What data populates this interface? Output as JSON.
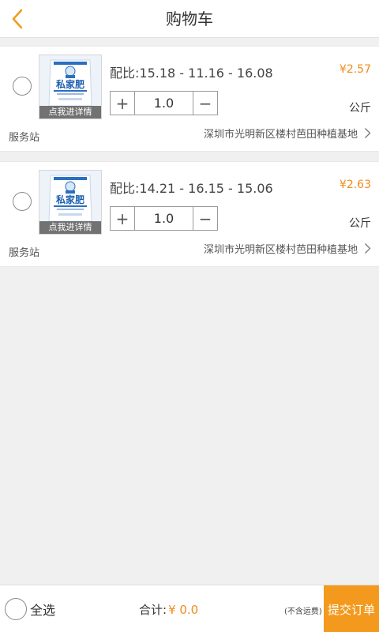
{
  "header": {
    "title": "购物车",
    "back_icon": "chevron-left-icon",
    "accent": "#f39a1e"
  },
  "items": [
    {
      "ratio": "配比:15.18 - 11.16 - 16.08",
      "price": "¥2.57",
      "quantity": "1.0",
      "unit": "公斤",
      "station_label": "服务站",
      "location": "深圳市光明新区楼村芭田种植基地",
      "thumbnail_caption": "点我进详情",
      "product_brand": "私家肥"
    },
    {
      "ratio": "配比:14.21 - 16.15 - 15.06",
      "price": "¥2.63",
      "quantity": "1.0",
      "unit": "公斤",
      "station_label": "服务站",
      "location": "深圳市光明新区楼村芭田种植基地",
      "thumbnail_caption": "点我进详情",
      "product_brand": "私家肥"
    }
  ],
  "stepper": {
    "plus": "+",
    "minus": "−"
  },
  "footer": {
    "select_all": "全选",
    "total_label": "合计:",
    "total_amount": "¥ 0.0",
    "shipping_note": "(不含运费)",
    "submit": "提交订单"
  },
  "colors": {
    "price": "#f08c1c",
    "submit_bg": "#f39a1e",
    "page_bg": "#f0f0f0"
  }
}
